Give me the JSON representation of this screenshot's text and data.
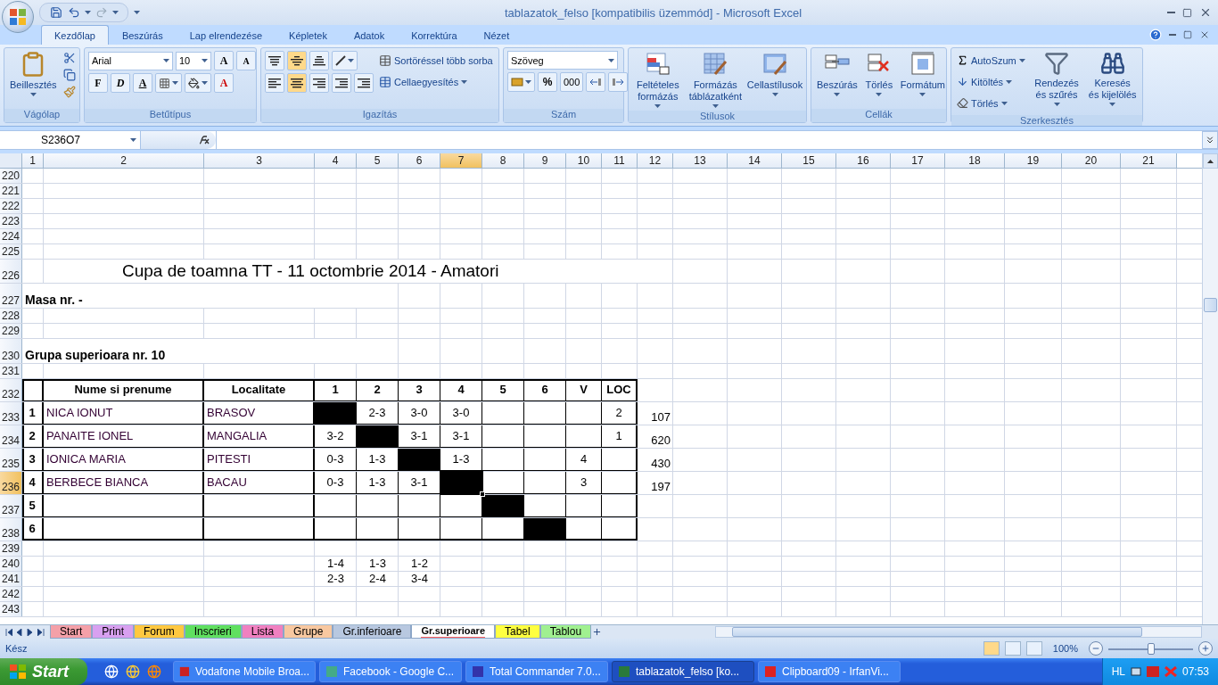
{
  "title_bar": {
    "title": "tablazatok_felso  [kompatibilis üzemmód] - Microsoft Excel"
  },
  "ribbon_tabs": [
    {
      "label": "Kezdőlap",
      "selected": true
    },
    {
      "label": "Beszúrás",
      "selected": false
    },
    {
      "label": "Lap elrendezése",
      "selected": false
    },
    {
      "label": "Képletek",
      "selected": false
    },
    {
      "label": "Adatok",
      "selected": false
    },
    {
      "label": "Korrektúra",
      "selected": false
    },
    {
      "label": "Nézet",
      "selected": false
    }
  ],
  "clipboard": {
    "label": "Vágólap",
    "paste": "Beillesztés"
  },
  "font": {
    "label": "Betűtípus",
    "name": "Arial",
    "size": "10",
    "grow": "A",
    "shrink": "A",
    "bold": "F",
    "italic": "D",
    "underline": "A",
    "font_color": "A"
  },
  "alignment": {
    "label": "Igazítás",
    "vertical": [
      {
        "selected": false
      },
      {
        "selected": true
      },
      {
        "selected": false
      }
    ],
    "horizontal": [
      {
        "selected": false
      },
      {
        "selected": true
      },
      {
        "selected": false
      }
    ],
    "wrap": "Sortöréssel több sorba",
    "merge": "Cellaegyesítés"
  },
  "number": {
    "label": "Szám",
    "format": "Szöveg",
    "percent": "%",
    "thousands": "000"
  },
  "styles": {
    "label": "Stílusok",
    "buttons": [
      "Feltételes formázás",
      "Formázás táblázatként",
      "Cellastílusok"
    ]
  },
  "cells": {
    "label": "Cellák",
    "buttons": [
      "Beszúrás",
      "Törlés",
      "Formátum"
    ]
  },
  "editing": {
    "label": "Szerkesztés",
    "small": [
      "AutoSzum",
      "Kitöltés",
      "Törlés"
    ],
    "large": [
      "Rendezés és szűrés",
      "Keresés és kijelölés"
    ]
  },
  "formula_bar": {
    "name_box": "S236O7"
  },
  "columns": [
    {
      "label": "1",
      "selected": false
    },
    {
      "label": "2",
      "selected": false
    },
    {
      "label": "3",
      "selected": false
    },
    {
      "label": "4",
      "selected": false
    },
    {
      "label": "5",
      "selected": false
    },
    {
      "label": "6",
      "selected": false
    },
    {
      "label": "7",
      "selected": true
    },
    {
      "label": "8",
      "selected": false
    },
    {
      "label": "9",
      "selected": false
    },
    {
      "label": "10",
      "selected": false
    },
    {
      "label": "11",
      "selected": false
    },
    {
      "label": "12",
      "selected": false
    },
    {
      "label": "13",
      "selected": false
    },
    {
      "label": "14",
      "selected": false
    },
    {
      "label": "15",
      "selected": false
    },
    {
      "label": "16",
      "selected": false
    },
    {
      "label": "17",
      "selected": false
    },
    {
      "label": "18",
      "selected": false
    },
    {
      "label": "19",
      "selected": false
    },
    {
      "label": "20",
      "selected": false
    },
    {
      "label": "21",
      "selected": false
    }
  ],
  "rows": [
    {
      "number": "220",
      "kind": "plain",
      "selected": false
    },
    {
      "number": "221",
      "kind": "plain",
      "selected": false
    },
    {
      "number": "222",
      "kind": "plain",
      "selected": false
    },
    {
      "number": "223",
      "kind": "plain",
      "selected": false
    },
    {
      "number": "224",
      "kind": "plain",
      "selected": false
    },
    {
      "number": "225",
      "kind": "plain",
      "selected": false
    },
    {
      "number": "226",
      "kind": "title",
      "selected": false,
      "cells": [
        {
          "kind": "empty"
        },
        {
          "kind": "title",
          "text": "Cupa de toamna TT - 11 octombrie 2014 - Amatori"
        }
      ]
    },
    {
      "number": "227",
      "kind": "label",
      "selected": false,
      "cells": [
        {
          "kind": "label",
          "text": "Masa nr.  -"
        }
      ]
    },
    {
      "number": "228",
      "kind": "plain",
      "selected": false
    },
    {
      "number": "229",
      "kind": "plain",
      "selected": false
    },
    {
      "number": "230",
      "kind": "label",
      "selected": false,
      "cells": [
        {
          "kind": "label",
          "text": "Grupa superioara nr. 10"
        }
      ]
    },
    {
      "number": "231",
      "kind": "plain",
      "selected": false
    },
    {
      "number": "232",
      "kind": "table",
      "selected": false,
      "cells": [
        {
          "kind": "empty"
        },
        {
          "kind": "heading",
          "text": "Nume si prenume"
        },
        {
          "kind": "heading",
          "text": "Localitate"
        },
        {
          "kind": "heading",
          "text": "1"
        },
        {
          "kind": "heading",
          "text": "2"
        },
        {
          "kind": "heading",
          "text": "3"
        },
        {
          "kind": "heading",
          "text": "4"
        },
        {
          "kind": "heading",
          "text": "5"
        },
        {
          "kind": "heading",
          "text": "6"
        },
        {
          "kind": "heading",
          "text": "V"
        },
        {
          "kind": "heading",
          "text": "LOC"
        }
      ]
    },
    {
      "number": "233",
      "kind": "table",
      "selected": false,
      "cells": [
        {
          "kind": "heading",
          "text": "1"
        },
        {
          "kind": "text",
          "text": "NICA IONUT"
        },
        {
          "kind": "text",
          "text": "BRASOV"
        },
        {
          "kind": "filled"
        },
        {
          "kind": "score",
          "text": "2-3"
        },
        {
          "kind": "score",
          "text": "3-0"
        },
        {
          "kind": "score",
          "text": "3-0"
        },
        {
          "kind": "empty"
        },
        {
          "kind": "empty"
        },
        {
          "kind": "empty"
        },
        {
          "kind": "score",
          "text": "2"
        },
        {
          "kind": "value",
          "text": "107"
        }
      ]
    },
    {
      "number": "234",
      "kind": "table",
      "selected": false,
      "cells": [
        {
          "kind": "heading",
          "text": "2"
        },
        {
          "kind": "text",
          "text": "PANAITE IONEL"
        },
        {
          "kind": "text",
          "text": "MANGALIA"
        },
        {
          "kind": "score",
          "text": "3-2"
        },
        {
          "kind": "filled"
        },
        {
          "kind": "score",
          "text": "3-1"
        },
        {
          "kind": "score",
          "text": "3-1"
        },
        {
          "kind": "empty"
        },
        {
          "kind": "empty"
        },
        {
          "kind": "empty"
        },
        {
          "kind": "score",
          "text": "1"
        },
        {
          "kind": "value",
          "text": "620"
        }
      ]
    },
    {
      "number": "235",
      "kind": "table",
      "selected": false,
      "cells": [
        {
          "kind": "heading",
          "text": "3"
        },
        {
          "kind": "text",
          "text": "IONICA MARIA"
        },
        {
          "kind": "text",
          "text": "PITESTI"
        },
        {
          "kind": "score",
          "text": "0-3"
        },
        {
          "kind": "score",
          "text": "1-3"
        },
        {
          "kind": "filled"
        },
        {
          "kind": "score",
          "text": "1-3"
        },
        {
          "kind": "empty"
        },
        {
          "kind": "empty"
        },
        {
          "kind": "score",
          "text": "4"
        },
        {
          "kind": "empty"
        },
        {
          "kind": "value",
          "text": "430"
        }
      ]
    },
    {
      "number": "236",
      "kind": "table",
      "selected": true,
      "cells": [
        {
          "kind": "heading",
          "text": "4"
        },
        {
          "kind": "text",
          "text": "BERBECE BIANCA"
        },
        {
          "kind": "text",
          "text": "BACAU"
        },
        {
          "kind": "score",
          "text": "0-3"
        },
        {
          "kind": "score",
          "text": "1-3"
        },
        {
          "kind": "score",
          "text": "3-1"
        },
        {
          "kind": "filled"
        },
        {
          "kind": "empty"
        },
        {
          "kind": "empty"
        },
        {
          "kind": "score",
          "text": "3"
        },
        {
          "kind": "empty"
        },
        {
          "kind": "value",
          "text": "197"
        }
      ]
    },
    {
      "number": "237",
      "kind": "table",
      "selected": false,
      "cells": [
        {
          "kind": "heading",
          "text": "5"
        },
        {
          "kind": "empty"
        },
        {
          "kind": "empty"
        },
        {
          "kind": "empty"
        },
        {
          "kind": "empty"
        },
        {
          "kind": "empty"
        },
        {
          "kind": "empty"
        },
        {
          "kind": "filled"
        }
      ]
    },
    {
      "number": "238",
      "kind": "table",
      "selected": false,
      "cells": [
        {
          "kind": "heading",
          "text": "6"
        },
        {
          "kind": "empty"
        },
        {
          "kind": "empty"
        },
        {
          "kind": "empty"
        },
        {
          "kind": "empty"
        },
        {
          "kind": "empty"
        },
        {
          "kind": "empty"
        },
        {
          "kind": "empty"
        },
        {
          "kind": "filled"
        }
      ]
    },
    {
      "number": "239",
      "kind": "plain",
      "selected": false
    },
    {
      "number": "240",
      "kind": "plain",
      "selected": false,
      "cells": [
        {
          "kind": "empty"
        },
        {
          "kind": "empty"
        },
        {
          "kind": "empty"
        },
        {
          "kind": "score",
          "text": "1-4"
        },
        {
          "kind": "score",
          "text": "1-3"
        },
        {
          "kind": "score",
          "text": "1-2"
        }
      ]
    },
    {
      "number": "241",
      "kind": "plain",
      "selected": false,
      "cells": [
        {
          "kind": "empty"
        },
        {
          "kind": "empty"
        },
        {
          "kind": "empty"
        },
        {
          "kind": "score",
          "text": "2-3"
        },
        {
          "kind": "score",
          "text": "2-4"
        },
        {
          "kind": "score",
          "text": "3-4"
        }
      ]
    },
    {
      "number": "242",
      "kind": "plain",
      "selected": false
    },
    {
      "number": "243",
      "kind": "plain",
      "selected": false
    }
  ],
  "sheet_tabs": [
    {
      "label": "Start",
      "color": "#f4a0a8",
      "selected": false
    },
    {
      "label": "Print",
      "color": "#d8a0f0",
      "selected": false
    },
    {
      "label": "Forum",
      "color": "#ffc840",
      "selected": false
    },
    {
      "label": "Inscrieri",
      "color": "#60e060",
      "selected": false
    },
    {
      "label": "Lista",
      "color": "#f080c0",
      "selected": false
    },
    {
      "label": "Grupe",
      "color": "#f8c8a0",
      "selected": false
    },
    {
      "label": "Gr.inferioare",
      "color": "#b8c8e0",
      "selected": false
    },
    {
      "label": "Gr.superioare",
      "color": "#ff6060",
      "selected": true
    },
    {
      "label": "Tabel",
      "color": "#ffff40",
      "selected": false
    },
    {
      "label": "Tablou",
      "color": "#a0f090",
      "selected": false
    }
  ],
  "status_bar": {
    "text": "Kész",
    "zoom": "100%",
    "zoom_slider": {
      "level": 0.5
    }
  },
  "taskbar": {
    "start": "Start",
    "tasks": [
      {
        "label": "Vodafone Mobile Broa...",
        "selected": false
      },
      {
        "label": "Facebook - Google C...",
        "selected": false
      },
      {
        "label": "Total Commander 7.0...",
        "selected": false
      },
      {
        "label": "tablazatok_felso  [ko...",
        "selected": true
      },
      {
        "label": "Clipboard09 - IrfanVi...",
        "selected": false
      }
    ],
    "language": "HL",
    "clock": "07:53"
  }
}
